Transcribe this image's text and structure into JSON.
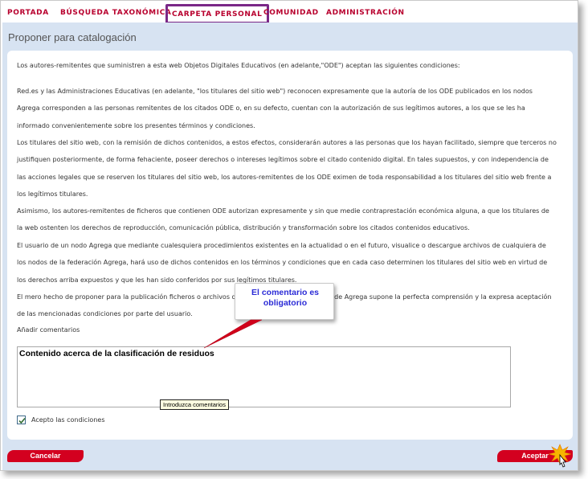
{
  "nav": {
    "items": [
      {
        "label": "PORTADA"
      },
      {
        "label": "BÚSQUEDA TAXONÓMICA"
      },
      {
        "label": "CARPETA PERSONAL"
      },
      {
        "label": "COMUNIDAD"
      },
      {
        "label": "ADMINISTRACIÓN"
      }
    ],
    "active_index": 2
  },
  "page": {
    "title": "Proponer para catalogación",
    "paragraphs": [
      "Los autores-remitentes que suministren a esta web Objetos Digitales Educativos (en adelante,\"ODE\") aceptan las siguientes condiciones:",
      "Red.es y las Administraciones Educativas (en adelante, \"los titulares del sitio web\") reconocen expresamente que la autoría de los ODE publicados en los nodos Agrega corresponden a las personas remitentes de los citados ODE o, en su defecto, cuentan con la autorización de sus legítimos autores, a los que se les ha informado convenientemente sobre los presentes términos y condiciones.",
      "Los titulares del sitio web, con la remisión de dichos contenidos, a estos efectos, considerarán autores a las personas que los hayan facilitado, siempre que terceros no justifiquen posteriormente, de forma fehaciente, poseer derechos o intereses legítimos sobre el citado contenido digital. En tales supuestos, y con independencia de las acciones legales que se reserven los titulares del sitio web, los autores-remitentes de los ODE eximen de toda responsabilidad a los titulares del sitio web frente a los legítimos titulares.",
      "Asimismo, los autores-remitentes de ficheros que contienen ODE autorizan expresamente y sin que medie contraprestación económica alguna, a que los titulares de la web ostenten los derechos de reproducción, comunicación pública, distribución y transformación sobre los citados contenidos educativos.",
      "El usuario de un nodo Agrega que mediante cualesquiera procedimientos existentes en la actualidad o en el futuro, visualice o descargue archivos de cualquiera de los nodos de la federación Agrega, hará uso de dichos contenidos en los términos y condiciones que en cada caso determinen los titulares del sitio web en virtud de los derechos arriba expuestos y que les han sido conferidos por sus legítimos titulares.",
      "El mero hecho de proponer para la publicación ficheros o archivos que contienen ODE en un nodo de Agrega supone la perfecta comprensión y la expresa aceptación de las mencionadas condiciones por parte del usuario."
    ],
    "comment_label": "Añadir comentarios",
    "comment_value": "Contenido acerca de la clasificación de residuos",
    "tooltip": "Introduzca comentarios",
    "accept_label": "Acepto las condiciones",
    "accept_checked": true,
    "cancel_label": "Cancelar",
    "accept_button_label": "Aceptar"
  },
  "callout": {
    "text": "El comentario es obligatorio"
  },
  "colors": {
    "nav_text": "#b8002e",
    "nav_active_border": "#7a2787",
    "page_background": "#d7e3f2",
    "button": "#d3001f",
    "callout_text": "#2b2bd6",
    "callout_arrow": "#d0001a"
  },
  "icons": {
    "checkbox": "check-icon",
    "cursor": "hand-cursor-icon",
    "click": "click-burst-icon"
  }
}
